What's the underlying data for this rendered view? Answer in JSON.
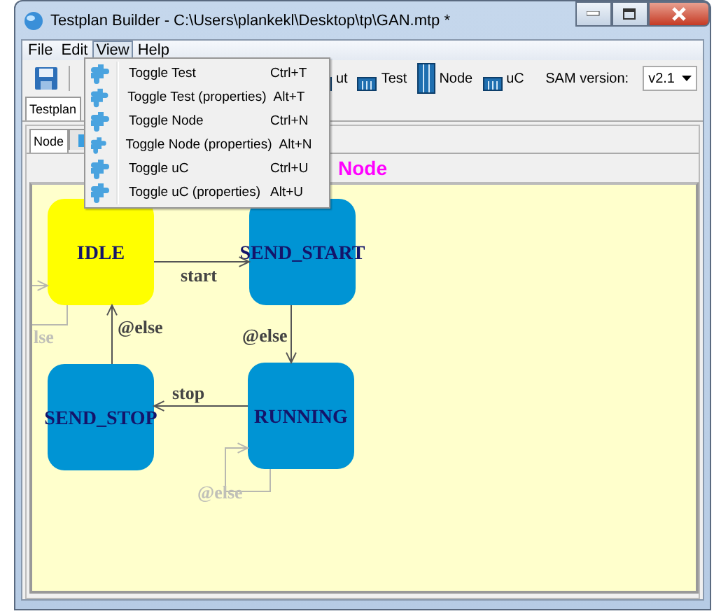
{
  "window": {
    "title": "Testplan Builder  - C:\\Users\\plankekl\\Desktop\\tp\\GAN.mtp *"
  },
  "menubar": [
    {
      "label": "File",
      "selected": false
    },
    {
      "label": "Edit",
      "selected": false
    },
    {
      "label": "View",
      "selected": true
    },
    {
      "label": "Help",
      "selected": false
    }
  ],
  "toolbar": {
    "items": [
      {
        "label": "ut",
        "kind": "table"
      },
      {
        "label": "Test",
        "kind": "table"
      },
      {
        "label": "Node",
        "kind": "columns"
      },
      {
        "label": "uC",
        "kind": "table"
      }
    ],
    "sam_version": {
      "label": "SAM version:",
      "value": "v2.1"
    }
  },
  "tabs": [
    {
      "label": "Testplan",
      "selected": true
    }
  ],
  "subtabs": [
    {
      "label": "Node",
      "selected": true
    },
    {
      "selected": false
    }
  ],
  "canvas": {
    "title": "Node",
    "nodes": [
      {
        "label": "IDLE",
        "color": "#ffff00"
      },
      {
        "label": "SEND_START",
        "color": "#0094d4"
      },
      {
        "label": "SEND_STOP",
        "color": "#0094d4"
      },
      {
        "label": "RUNNING",
        "color": "#0094d4"
      }
    ],
    "edges": [
      {
        "label": "start",
        "faded": false
      },
      {
        "label": "@else",
        "faded": false
      },
      {
        "label": "stop",
        "faded": false
      },
      {
        "label": "@else",
        "faded": false
      },
      {
        "label": "lse",
        "faded": true
      },
      {
        "label": "@else",
        "faded": true
      }
    ]
  },
  "view_menu": [
    {
      "label": "Toggle Test",
      "shortcut": "Ctrl+T"
    },
    {
      "label": "Toggle Test (properties)",
      "shortcut": "Alt+T"
    },
    {
      "label": "Toggle Node",
      "shortcut": "Ctrl+N"
    },
    {
      "label": "Toggle Node (properties)",
      "shortcut": "Alt+N"
    },
    {
      "label": "Toggle uC",
      "shortcut": "Ctrl+U"
    },
    {
      "label": "Toggle uC (properties)",
      "shortcut": "Alt+U"
    }
  ]
}
